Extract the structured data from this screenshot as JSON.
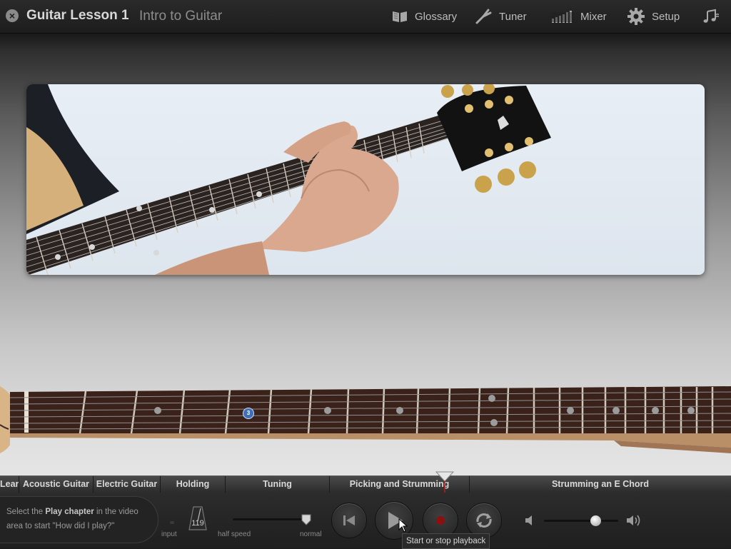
{
  "app": {
    "title": "Guitar Lesson 1",
    "subtitle": "Intro to Guitar"
  },
  "nav": [
    {
      "label": "Glossary",
      "icon": "book-icon"
    },
    {
      "label": "Tuner",
      "icon": "tuning-fork-icon"
    },
    {
      "label": "Mixer",
      "icon": "mixer-bars-icon"
    },
    {
      "label": "Setup",
      "icon": "gear-icon"
    },
    {
      "label": "",
      "icon": "music-note-icon"
    }
  ],
  "chapters": [
    {
      "label": "Lear"
    },
    {
      "label": "Acoustic Guitar"
    },
    {
      "label": "Electric Guitar"
    },
    {
      "label": "Holding"
    },
    {
      "label": "Tuning"
    },
    {
      "label": "Picking and Strumming"
    },
    {
      "label": "Strumming an E Chord"
    }
  ],
  "fretboard": {
    "finger_marker": "3"
  },
  "controls": {
    "hint_parts": [
      "Select the ",
      "Play chapter",
      " in the video area to start \"How did I play?\""
    ],
    "input_label": "input",
    "tempo": "119",
    "half_speed_label": "half speed",
    "normal_label": "normal",
    "tooltip": "Start or stop playback",
    "volume_level": 0.7,
    "speed_level": 1.0
  },
  "colors": {
    "record": "#8b1010",
    "background_top": "#1b1b1c"
  }
}
